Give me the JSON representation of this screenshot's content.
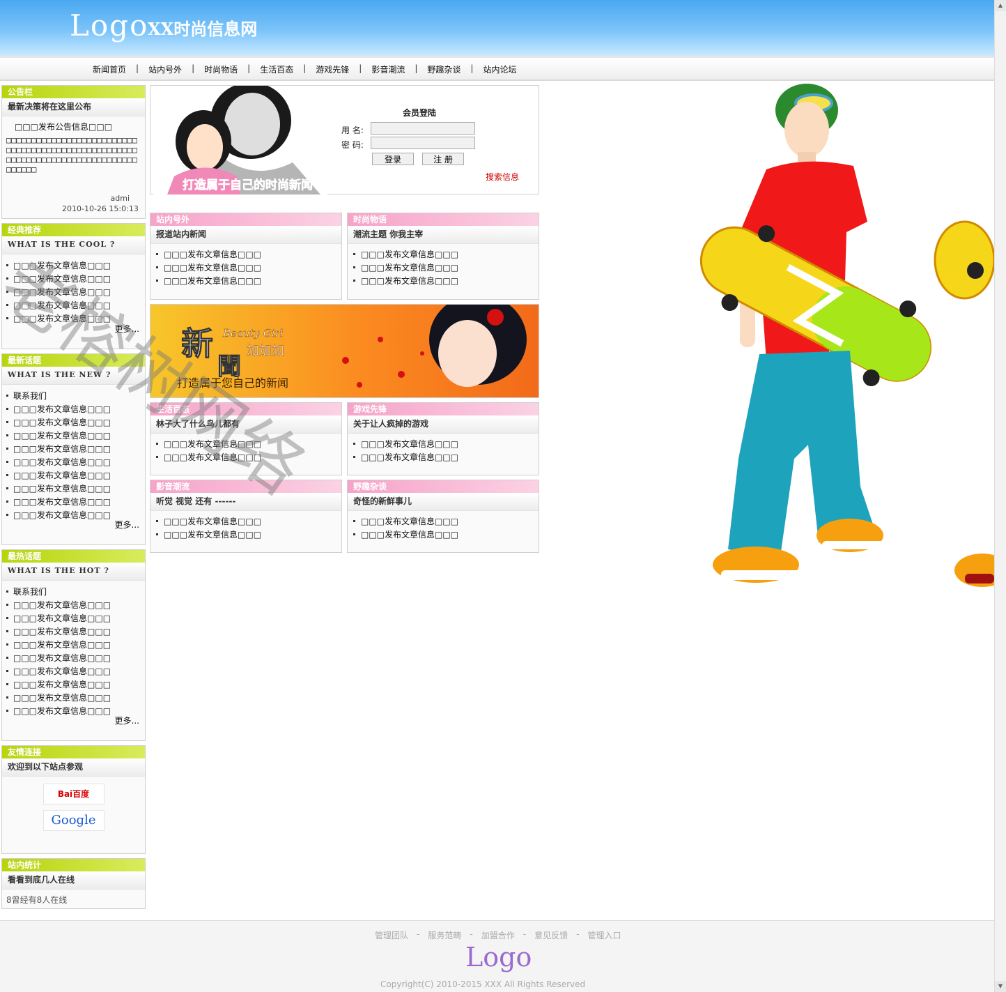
{
  "header": {
    "logo": "Logo",
    "site_name": "XX时尚信息网"
  },
  "nav": [
    "新闻首页",
    "站内号外",
    "时尚物语",
    "生活百态",
    "游戏先锋",
    "影音潮流",
    "野趣杂谈",
    "站内论坛"
  ],
  "nav_separator": "|",
  "notice": {
    "title": "公告栏",
    "subtitle": "最新决策将在这里公布",
    "text": "□□□发布公告信息□□□",
    "body": "□□□□□□□□□□□□□□□□□□□□□□□□□□□□□□□□□□□□□□□□□□□□□□□□□□□□□□□□□□□□□□□□□□□□□□□□□□□□□□□□□□□□",
    "author": "admi",
    "date": "2010-10-26 15:0:13"
  },
  "classic": {
    "title": "经典推荐",
    "subtitle": "WHAT IS THE COOL ?",
    "items": [
      "□□□发布文章信息□□□",
      "□□□发布文章信息□□□",
      "□□□发布文章信息□□□",
      "□□□发布文章信息□□□",
      "□□□发布文章信息□□□"
    ],
    "more": "更多..."
  },
  "newest": {
    "title": "最新话题",
    "subtitle": "WHAT IS THE NEW ?",
    "items": [
      "联系我们",
      "□□□发布文章信息□□□",
      "□□□发布文章信息□□□",
      "□□□发布文章信息□□□",
      "□□□发布文章信息□□□",
      "□□□发布文章信息□□□",
      "□□□发布文章信息□□□",
      "□□□发布文章信息□□□",
      "□□□发布文章信息□□□",
      "□□□发布文章信息□□□"
    ],
    "more": "更多..."
  },
  "hottest": {
    "title": "最热话题",
    "subtitle": "WHAT IS THE HOT ?",
    "items": [
      "联系我们",
      "□□□发布文章信息□□□",
      "□□□发布文章信息□□□",
      "□□□发布文章信息□□□",
      "□□□发布文章信息□□□",
      "□□□发布文章信息□□□",
      "□□□发布文章信息□□□",
      "□□□发布文章信息□□□",
      "□□□发布文章信息□□□",
      "□□□发布文章信息□□□"
    ],
    "more": "更多..."
  },
  "friends": {
    "title": "友情连接",
    "subtitle": "欢迎到以下站点参观",
    "baidu": "Bai百度",
    "google": "Google"
  },
  "stats": {
    "title": "站内统计",
    "subtitle": "看看到底几人在线",
    "text": "8曾经有8人在线"
  },
  "login": {
    "title": "会员登陆",
    "user_label": "用 名:",
    "pass_label": "密 码:",
    "login_btn": "登录",
    "register_btn": "注 册",
    "search_link": "搜索信息",
    "banner_slogan": "打造属于自己的时尚新闻"
  },
  "sections": [
    {
      "title": "站内号外",
      "subtitle": "报道站内新闻",
      "items": [
        "□□□发布文章信息□□□",
        "□□□发布文章信息□□□",
        "□□□发布文章信息□□□"
      ]
    },
    {
      "title": "时尚物语",
      "subtitle": "潮流主题 你我主宰",
      "items": [
        "□□□发布文章信息□□□",
        "□□□发布文章信息□□□",
        "□□□发布文章信息□□□"
      ]
    },
    {
      "title": "生活百态",
      "subtitle": "林子大了什么鸟儿都有",
      "items": [
        "□□□发布文章信息□□□",
        "□□□发布文章信息□□□"
      ]
    },
    {
      "title": "游戏先锋",
      "subtitle": "关于让人疯掉的游戏",
      "items": [
        "□□□发布文章信息□□□",
        "□□□发布文章信息□□□"
      ]
    },
    {
      "title": "影音潮流",
      "subtitle": "听觉 视觉 还有 ------",
      "items": [
        "□□□发布文章信息□□□",
        "□□□发布文章信息□□□"
      ]
    },
    {
      "title": "野趣杂谈",
      "subtitle": "奇怪的新鲜事儿",
      "items": [
        "□□□发布文章信息□□□",
        "□□□发布文章信息□□□"
      ]
    }
  ],
  "banner": {
    "big_char_1": "新",
    "big_char_2": "聞",
    "script": "Beauty Girl",
    "jiajia": "加加加",
    "slogan": "打造属于您自己的新闻"
  },
  "footer": {
    "links": [
      "管理团队",
      "服务范畴",
      "加盟合作",
      "意见反馈",
      "管理入口"
    ],
    "link_sep": "-",
    "logo": "Logo",
    "copyright": "Copyright(C) 2010-2015      XXX  All Rights Reserved"
  },
  "watermark": "老榕树网络",
  "colors": {
    "header_blue": "#4aa8f0",
    "green_head": "#b7d40c",
    "pink_head": "#f6a3c8",
    "search_red": "#cc0000",
    "footer_logo": "#9a6ad0"
  }
}
